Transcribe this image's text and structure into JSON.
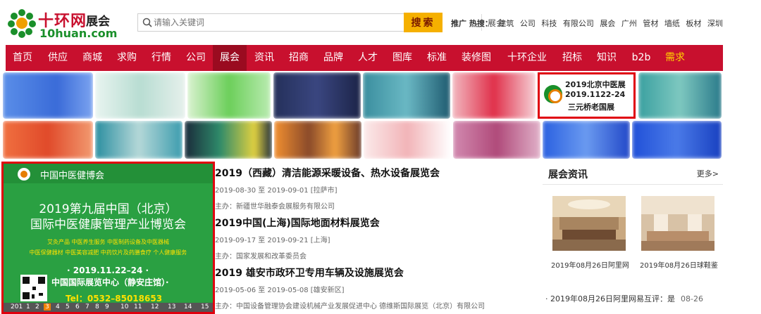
{
  "header": {
    "logo_cn": "十环网",
    "logo_cn2": "展会",
    "logo_en_prefix": "10",
    "logo_en_suffix": "huan.com",
    "search_placeholder": "请输入关键词",
    "search_category": "展会",
    "search_button": "搜索",
    "hot_label": "推广 热搜：",
    "hot_keywords": [
      "建筑",
      "公司",
      "科技",
      "有限公司",
      "展会",
      "广州",
      "管材",
      "墙纸",
      "板材",
      "深圳"
    ]
  },
  "nav": {
    "items": [
      "首页",
      "供应",
      "商城",
      "求购",
      "行情",
      "公司",
      "展会",
      "资讯",
      "招商",
      "品牌",
      "人才",
      "图库",
      "标准",
      "装修图",
      "十环企业",
      "招标",
      "知识",
      "b2b",
      "需求"
    ],
    "active": "展会",
    "highlight": "需求"
  },
  "banner_highlight": {
    "line1": "2019北京中医展",
    "line2": "2019.1122-24",
    "line3": "三元桥老国展"
  },
  "big_ad": {
    "org": "中国中医健博会",
    "title1": "2019第九届中国（北京）",
    "title2": "国际中医健康管理产业博览会",
    "tags1": "艾灸产品  中医养生服务  中医制药设备及中医器械",
    "tags2": "中医保健器材  中医美容减肥  中药饮片及药膳食疗  个人健康服务",
    "date": "· 2019.11.22–24 ·",
    "venue": "中国国际展览中心（静安庄馆）·",
    "tel": "Tel：0532–85018653",
    "pages": [
      "201",
      "1",
      "2",
      "3",
      "4",
      "5",
      "6",
      "7",
      "8",
      "9",
      "10",
      "11",
      "12",
      "13",
      "14",
      "15"
    ],
    "current_page": "3"
  },
  "expos": [
    {
      "title": "2019（西藏）清洁能源采暖设备、热水设备展览会",
      "date": "2019-08-30 至 2019-09-01 [拉萨市]",
      "host": "主办：新疆世华融泰会展服务有限公司"
    },
    {
      "title": "2019中国(上海)国际地面材料展览会",
      "date": "2019-09-17 至 2019-09-21 [上海]",
      "host": "主办：国家发展和改革委员会"
    },
    {
      "title": "2019 雄安市政环卫专用车辆及设施展览会",
      "date": "2019-05-06 至 2019-05-08 [雄安新区]",
      "host": "主办：中国设备管理协会建设机械产业发展促进中心 德维斯国际展览（北京）有限公司"
    }
  ],
  "side": {
    "title": "展会资讯",
    "more": "更多>",
    "captions": [
      "2019年08月26日阿里网",
      "2019年08月26日球鞋鉴"
    ],
    "news_title": "· 2019年08月26日阿里网易互评：是",
    "news_date": "08-26"
  },
  "colors": {
    "brand_red": "#c8102e",
    "nav_active": "#9a0b20",
    "search_btn": "#f5b000",
    "ad_green": "#2aa042",
    "highlight_border": "#e0000e"
  }
}
